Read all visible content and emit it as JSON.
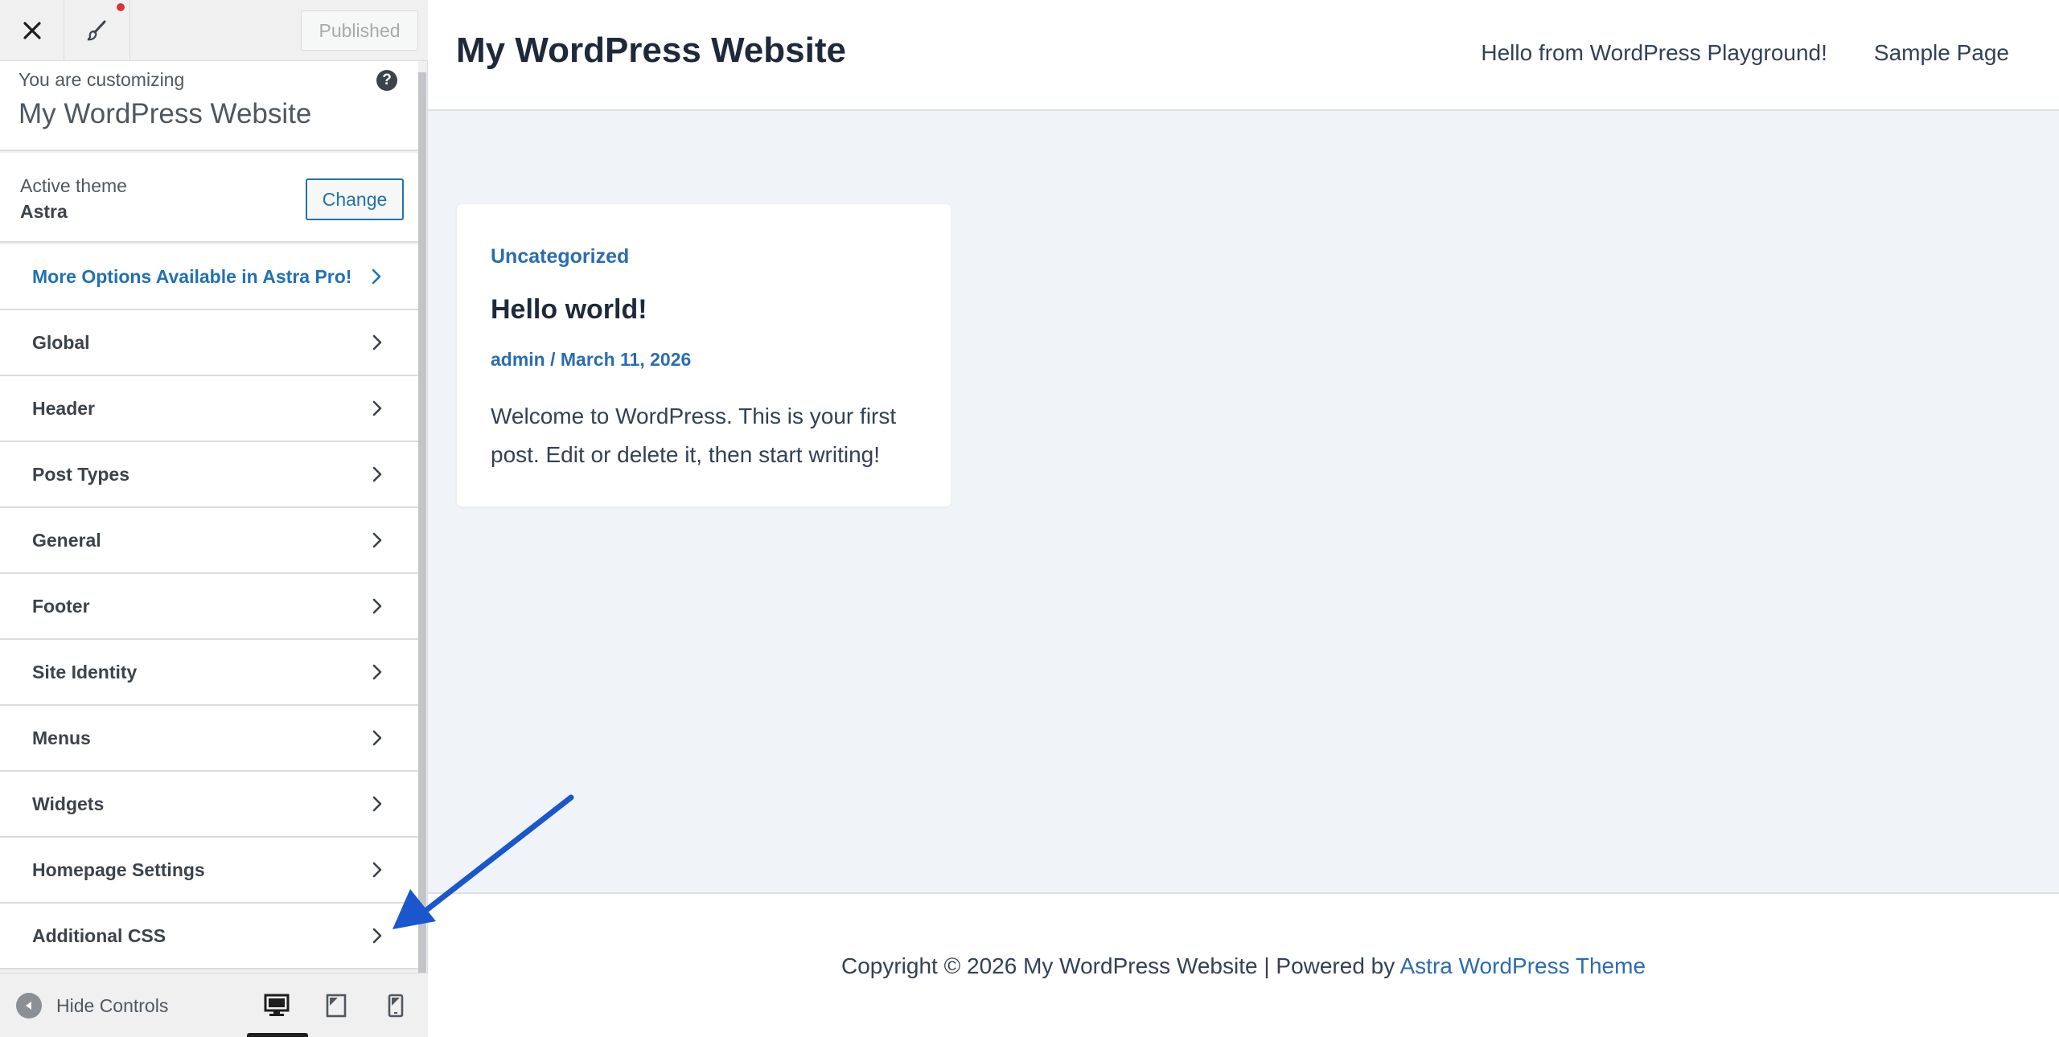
{
  "sidebar": {
    "top": {
      "close_icon": "close-icon",
      "brush_icon": "paintbrush-icon",
      "published_label": "Published"
    },
    "customizing": {
      "label": "You are customizing",
      "site_name": "My WordPress Website",
      "help_icon": "help-icon",
      "help_glyph": "?"
    },
    "theme": {
      "label": "Active theme",
      "name": "Astra",
      "change_label": "Change"
    },
    "items": [
      {
        "label": "More Options Available in Astra Pro!",
        "promo": true
      },
      {
        "label": "Global"
      },
      {
        "label": "Header"
      },
      {
        "label": "Post Types"
      },
      {
        "label": "General"
      },
      {
        "label": "Footer"
      },
      {
        "label": "Site Identity"
      },
      {
        "label": "Menus"
      },
      {
        "label": "Widgets"
      },
      {
        "label": "Homepage Settings"
      },
      {
        "label": "Additional CSS"
      }
    ],
    "bottom": {
      "hide_controls_label": "Hide Controls",
      "devices": [
        "desktop",
        "tablet",
        "mobile"
      ],
      "active_device": "desktop"
    }
  },
  "preview": {
    "site_title": "My WordPress Website",
    "nav": [
      "Hello from WordPress Playground!",
      "Sample Page"
    ],
    "post": {
      "category": "Uncategorized",
      "title": "Hello world!",
      "meta": "admin / March 11, 2026",
      "excerpt": "Welcome to WordPress. This is your first post. Edit or delete it, then start writing!"
    },
    "footer": {
      "prefix": "Copyright © 2026 My WordPress Website | Powered by ",
      "link": "Astra WordPress Theme"
    }
  },
  "colors": {
    "accent": "#2271b1",
    "link": "#2b6cb0",
    "annotation_arrow": "#1a56cc"
  }
}
